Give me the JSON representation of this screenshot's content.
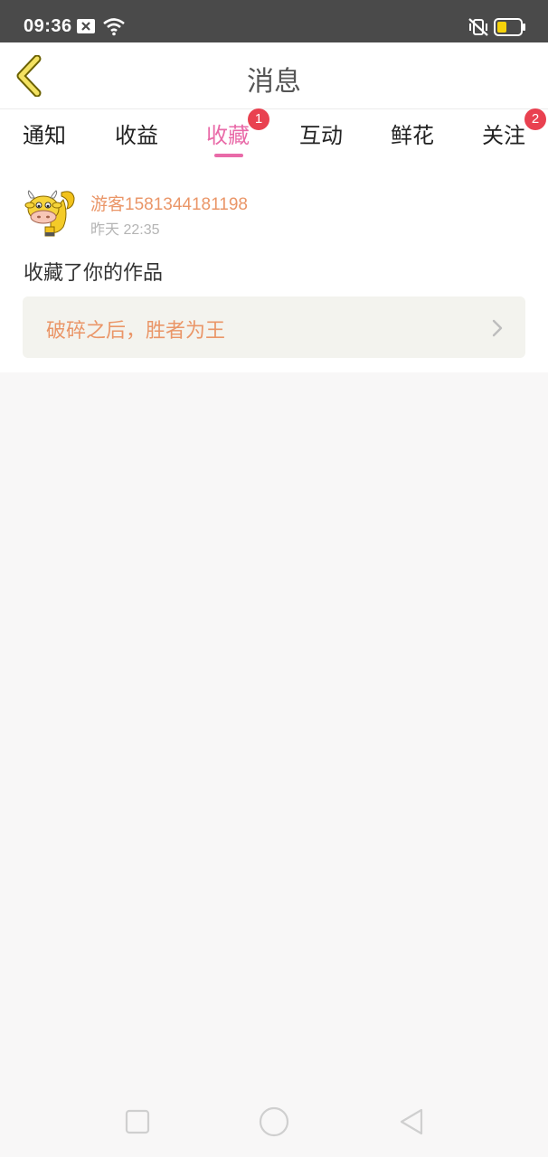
{
  "status_bar": {
    "time": "09:36",
    "icons": [
      "notification-x-icon",
      "wifi-icon",
      "vibrate-off-icon",
      "battery-icon"
    ],
    "battery_color": "#f5d20a"
  },
  "header": {
    "back_icon": "back-arrow-icon",
    "title": "消息"
  },
  "tabs": [
    {
      "label": "通知",
      "active": false,
      "badge": ""
    },
    {
      "label": "收益",
      "active": false,
      "badge": ""
    },
    {
      "label": "收藏",
      "active": true,
      "badge": "1"
    },
    {
      "label": "互动",
      "active": false,
      "badge": ""
    },
    {
      "label": "鲜花",
      "active": false,
      "badge": ""
    },
    {
      "label": "关注",
      "active": false,
      "badge": "2"
    }
  ],
  "message": {
    "username": "游客1581344181198",
    "time": "昨天 22:35",
    "action": "收藏了你的作品",
    "work_title": "破碎之后，胜者为王"
  },
  "nav_bar": {
    "icons": [
      "recent-apps-icon",
      "home-icon",
      "back-icon"
    ]
  },
  "colors": {
    "accent": "#e96aa8",
    "badge": "#e94150",
    "orange_text": "#ea9668"
  }
}
